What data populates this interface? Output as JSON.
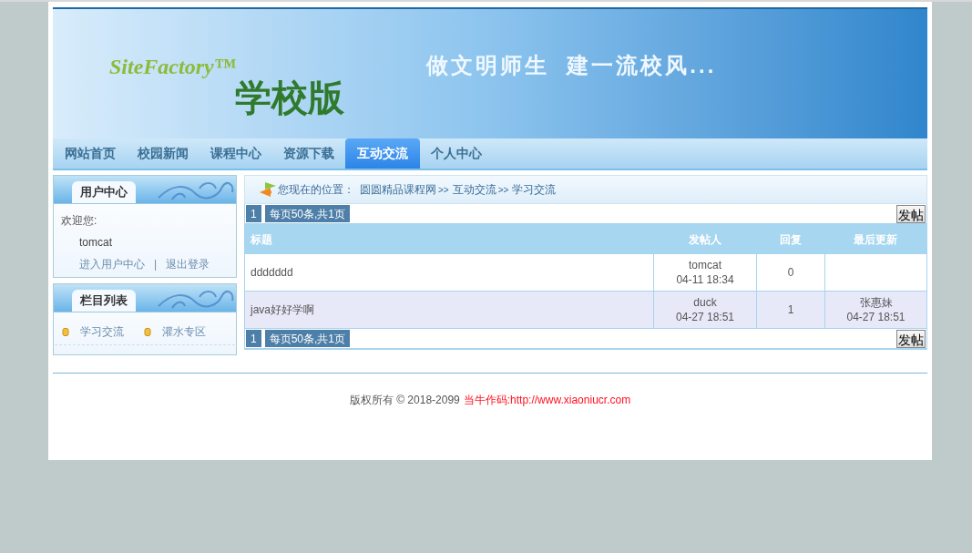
{
  "banner": {
    "brand": "SiteFactory™",
    "edition": "学校版",
    "slogan": "做文明师生  建一流校风..."
  },
  "nav": [
    {
      "label": "网站首页",
      "selected": false
    },
    {
      "label": "校园新闻",
      "selected": false
    },
    {
      "label": "课程中心",
      "selected": false
    },
    {
      "label": "资源下载",
      "selected": false
    },
    {
      "label": "互动交流",
      "selected": true
    },
    {
      "label": "个人中心",
      "selected": false
    }
  ],
  "user_center": {
    "title": "用户中心",
    "welcome": "欢迎您:",
    "username": "tomcat",
    "links": [
      "进入用户中心",
      "退出登录"
    ],
    "separator": "|"
  },
  "column_list": {
    "title": "栏目列表",
    "items": [
      "学习交流",
      "灌水专区"
    ]
  },
  "breadcrumb": {
    "label": "您现在的位置：",
    "items": [
      "圆圆精品课程网",
      "互动交流",
      "学习交流"
    ],
    "separator": ">>"
  },
  "pager_top": {
    "page": "1",
    "info": "每页50条,共1页",
    "button": "发帖"
  },
  "table": {
    "columns": [
      "标题",
      "发帖人",
      "回复",
      "最后更新"
    ],
    "rows": [
      {
        "title": "ddddddd",
        "poster": "tomcat",
        "posted": "04-11 18:34",
        "replies": "0",
        "last_user": "",
        "last_time": ""
      },
      {
        "title": "java好好学啊",
        "poster": "duck",
        "posted": "04-27 18:51",
        "replies": "1",
        "last_user": "张惠妹",
        "last_time": "04-27 18:51"
      }
    ]
  },
  "pager_bottom": {
    "page": "1",
    "info": "每页50条,共1页",
    "button": "发帖"
  },
  "footer": {
    "copyright": "版权所有 © 2018-2099",
    "credit": "当牛作码:http://www.xiaoniucr.com"
  }
}
